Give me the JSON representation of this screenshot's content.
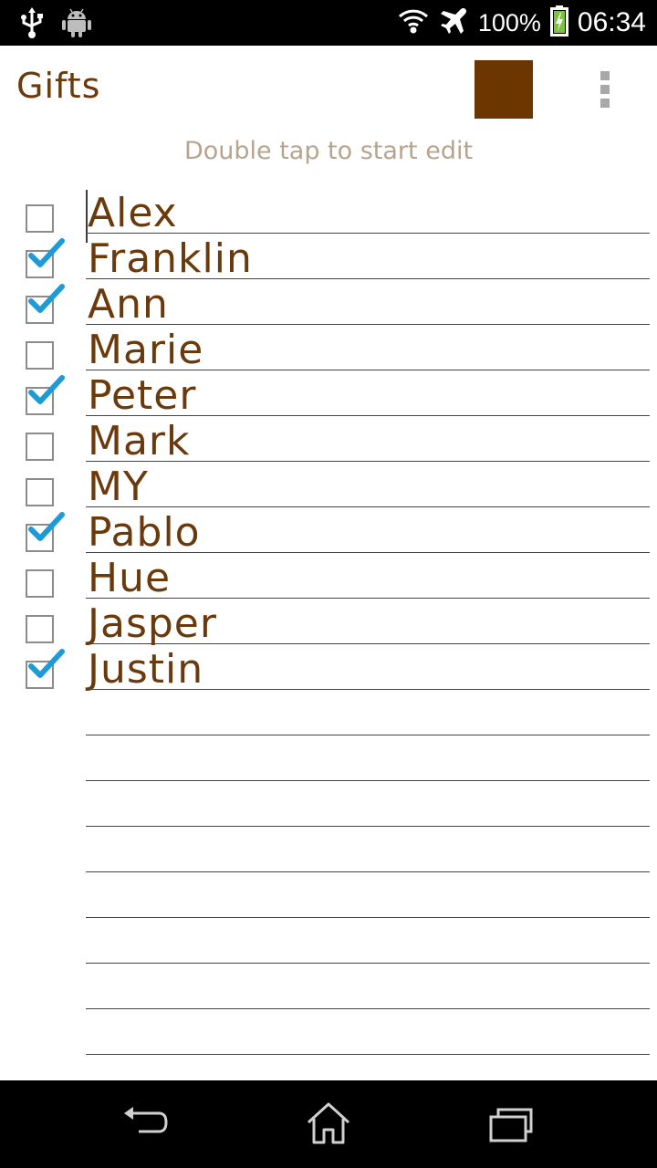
{
  "status_bar": {
    "battery_percent": "100%",
    "time": "06:34",
    "icons": [
      "usb-icon",
      "android-icon",
      "wifi-icon",
      "airplane-mode-icon",
      "battery-charging-icon"
    ]
  },
  "action_bar": {
    "title": "Gifts",
    "swatch_color": "#6b3600",
    "overflow_icon": "overflow-menu-icon"
  },
  "hint": "Double tap to start edit",
  "list": {
    "items": [
      {
        "text": "Alex",
        "checked": false
      },
      {
        "text": "Franklin",
        "checked": true
      },
      {
        "text": "Ann",
        "checked": true
      },
      {
        "text": "Marie",
        "checked": false
      },
      {
        "text": "Peter",
        "checked": true
      },
      {
        "text": "Mark",
        "checked": false
      },
      {
        "text": "MY",
        "checked": false
      },
      {
        "text": "Pablo",
        "checked": true
      },
      {
        "text": "Hue",
        "checked": false
      },
      {
        "text": "Jasper",
        "checked": false
      },
      {
        "text": "Justin",
        "checked": true
      }
    ],
    "empty_lines": 8
  },
  "colors": {
    "text_brown": "#6b3a0c",
    "hint": "#b7a48e",
    "check_blue": "#1e9bd7"
  },
  "nav_bar": {
    "icons": [
      "back-icon",
      "home-icon",
      "recent-apps-icon"
    ]
  }
}
